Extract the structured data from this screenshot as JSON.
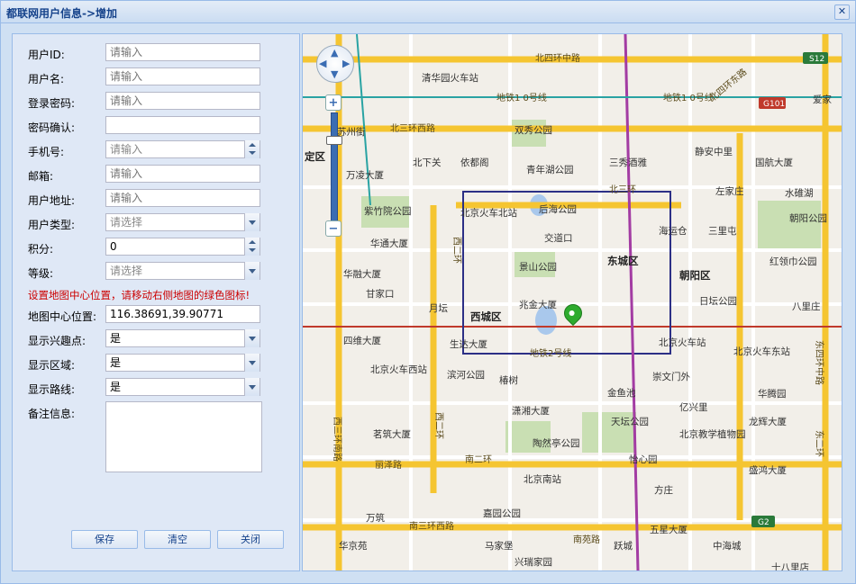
{
  "window": {
    "title": "都联网用户信息->增加",
    "close_glyph": "✕"
  },
  "form": {
    "fields": [
      {
        "label": "用户ID:",
        "value": "",
        "placeholder": "请输入",
        "type": "text"
      },
      {
        "label": "用户名:",
        "value": "",
        "placeholder": "请输入",
        "type": "text"
      },
      {
        "label": "登录密码:",
        "value": "",
        "placeholder": "请输入",
        "type": "text"
      },
      {
        "label": "密码确认:",
        "value": "",
        "placeholder": "",
        "type": "text"
      },
      {
        "label": "手机号:",
        "value": "",
        "placeholder": "请输入",
        "type": "spinner"
      },
      {
        "label": "邮箱:",
        "value": "",
        "placeholder": "请输入",
        "type": "text"
      },
      {
        "label": "用户地址:",
        "value": "",
        "placeholder": "请输入",
        "type": "text"
      },
      {
        "label": "用户类型:",
        "value": "",
        "placeholder": "请选择",
        "type": "combo"
      },
      {
        "label": "积分:",
        "value": "0",
        "placeholder": "",
        "type": "spinner"
      },
      {
        "label": "等级:",
        "value": "",
        "placeholder": "请选择",
        "type": "combo"
      }
    ],
    "notice": "设置地图中心位置，请移动右侧地图的绿色图标!",
    "fields2": [
      {
        "label": "地图中心位置:",
        "value": "116.38691,39.90771",
        "placeholder": "",
        "type": "text"
      },
      {
        "label": "显示兴趣点:",
        "value": "是",
        "placeholder": "",
        "type": "combo"
      },
      {
        "label": "显示区域:",
        "value": "是",
        "placeholder": "",
        "type": "combo"
      },
      {
        "label": "显示路线:",
        "value": "是",
        "placeholder": "",
        "type": "combo"
      }
    ],
    "remark_label": "备注信息:",
    "buttons": {
      "save": "保存",
      "clear": "清空",
      "close": "关闭"
    }
  },
  "map": {
    "zoom_in": "+",
    "zoom_out": "−",
    "labels": {
      "bei4": "北四环中路",
      "qinghua": "清华园火车站",
      "subway10": "地铁1 0号线",
      "subway10b": "地铁1 0号线",
      "bei3": "北三环西路",
      "shuangxiu": "双秀公园",
      "beixiaguan": "北下关",
      "yiheyuan": "依都阁",
      "qingnian": "青年湖公园",
      "sanmao": "三秀酒雅",
      "beisanhuan": "北三环",
      "jinganzhong": "静安中里",
      "guohang": "国航大厦",
      "zuojiazhuang": "左家庄",
      "shuiduhu": "水碓湖",
      "chaoyanggy": "朝阳公园",
      "zizhuyuan": "紫竹院公园",
      "beijingbei": "北京火车北站",
      "houhai": "后海公园",
      "haiyuncang": "海运仓",
      "sanlitun": "三里屯",
      "jiaodaokou": "交道口",
      "huatong": "华通大厦",
      "jingshan": "景山公园",
      "dongcheng": "东城区",
      "chaoyang": "朝阳区",
      "hongling": "红领巾公园",
      "huarong": "华融大厦",
      "ganjiakou": "甘家口",
      "rishan": "日坛公园",
      "yuetan": "月坛",
      "xicheng": "西城区",
      "zhaojin": "兆金大厦",
      "baliuzhuang": "八里庄",
      "siwei": "四维大厦",
      "shengda": "生达大厦",
      "subway2": "地铁2号线",
      "beijingzhan": "北京火车站",
      "beijingdong": "北京火车东站",
      "beijingxi": "北京火车西站",
      "binhe": "滨河公园",
      "chongwenmen": "崇文门外",
      "changshu": "椿树",
      "jinyuchi": "金鱼池",
      "huateng": "华腾园",
      "manliu": "潇湘大厦",
      "yixinli": "亿兴里",
      "tianqiao": "天坛公园",
      "longhui": "龙辉大厦",
      "maozhu": "茗筑大厦",
      "jiaoyu": "北京教学植物园",
      "taoran": "陶然亭公园",
      "lize": "丽泽路",
      "nanerhuan": "南二环",
      "yixinyuan": "怡心园",
      "shenghong": "盛鸿大厦",
      "beijingnan": "北京南站",
      "fangzhuang": "方庄",
      "wanzhu": "万筑",
      "nansanhuan": "南三环西路",
      "jiayuan": "嘉园公园",
      "wuxing": "五星大厦",
      "huajing": "华京苑",
      "majiabao": "马家堡",
      "nanyuanlu": "南苑路",
      "yueqiao": "跃城",
      "zhonghai": "中海城",
      "xingtai": "兴瑞家园",
      "shibali": "十八里店",
      "dingqu": "定区",
      "suzhoujie": "苏州街",
      "wanling": "万凌大厦",
      "aijia": "爱家",
      "chaoyangqu": "朝阳区",
      "g101": "G101",
      "s12": "S12",
      "g2": "G2",
      "xi2": "西二环",
      "xi3": "西三环南路",
      "dong2": "东二环",
      "dong4": "东四环中路",
      "bei4dong": "北四环东路"
    }
  }
}
